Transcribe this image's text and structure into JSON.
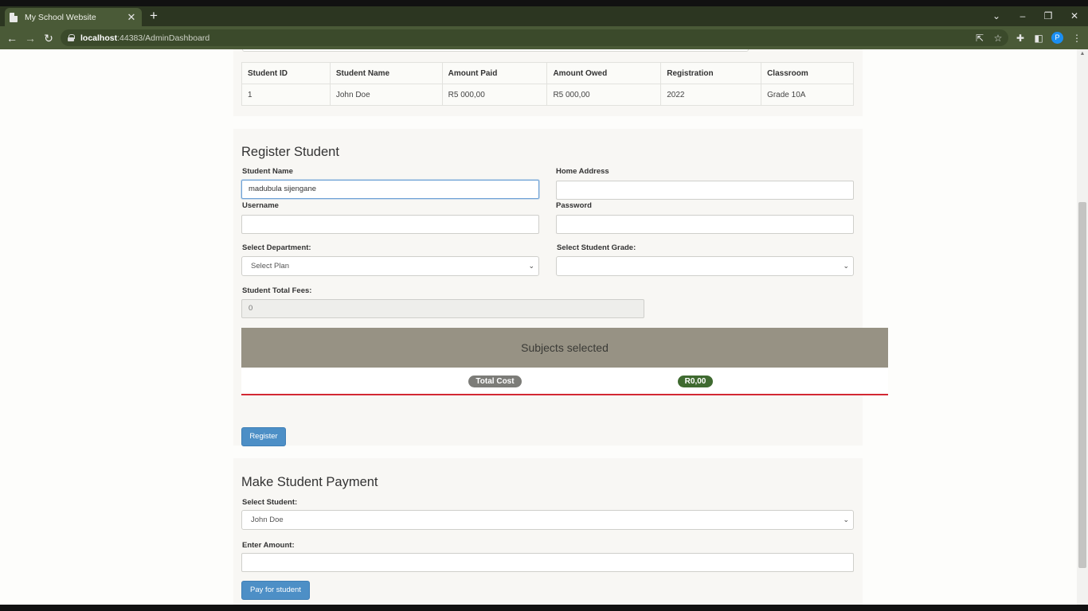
{
  "browser": {
    "tab_title": "My School Website",
    "tab_close": "✕",
    "new_tab": "+",
    "url_host": "localhost",
    "url_rest": ":44383/AdminDashboard",
    "profile_initial": "P"
  },
  "students_table": {
    "headers": [
      "Student ID",
      "Student Name",
      "Amount Paid",
      "Amount Owed",
      "Registration",
      "Classroom"
    ],
    "rows": [
      [
        "1",
        "John Doe",
        "R5 000,00",
        "R5 000,00",
        "2022",
        "Grade 10A"
      ]
    ]
  },
  "register": {
    "title": "Register Student",
    "student_name_label": "Student Name",
    "student_name_value": "madubula sijengane",
    "home_address_label": "Home Address",
    "home_address_value": "",
    "username_label": "Username",
    "username_value": "",
    "password_label": "Password",
    "password_value": "",
    "department_label": "Select Department:",
    "department_selected": "Select Plan",
    "grade_label": "Select Student Grade:",
    "grade_selected": "",
    "total_fees_label": "Student Total Fees:",
    "total_fees_value": "0",
    "subjects_header": "Subjects selected",
    "total_cost_label": "Total Cost",
    "total_cost_value": "R0,00",
    "register_button": "Register"
  },
  "payment": {
    "title": "Make Student Payment",
    "select_student_label": "Select Student:",
    "select_student_selected": "John Doe",
    "amount_label": "Enter Amount:",
    "amount_value": "",
    "pay_button": "Pay for student"
  },
  "colors": {
    "chrome_dark": "#2c3621",
    "chrome_toolbar": "#4a5a37",
    "button_blue": "#4d8fc6",
    "subjects_header": "#979284",
    "badge_green": "#3f6a30",
    "accent_red": "#d32833"
  }
}
